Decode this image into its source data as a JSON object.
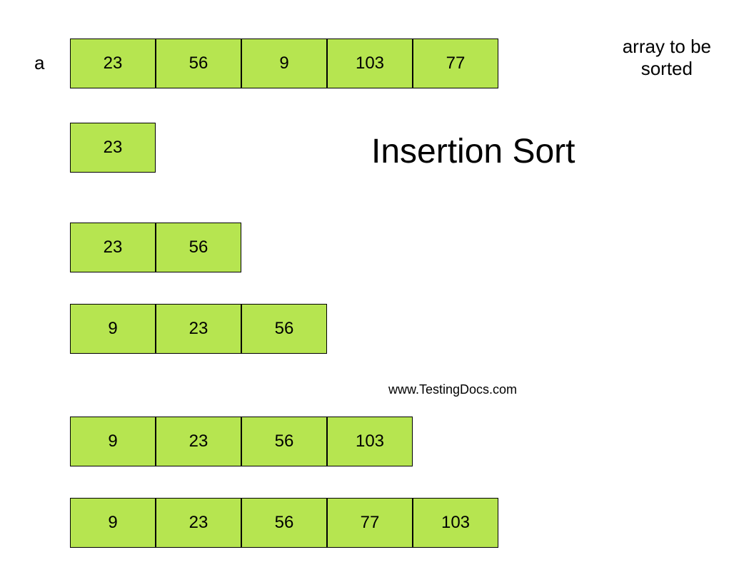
{
  "label": "a",
  "description_line1": "array to be",
  "description_line2": "sorted",
  "title": "Insertion Sort",
  "credit": "www.TestingDocs.com",
  "rows": [
    [
      "23",
      "56",
      "9",
      "103",
      "77"
    ],
    [
      "23"
    ],
    [
      "23",
      "56"
    ],
    [
      "9",
      "23",
      "56"
    ],
    [
      "9",
      "23",
      "56",
      "103"
    ],
    [
      "9",
      "23",
      "56",
      "77",
      "103"
    ]
  ]
}
